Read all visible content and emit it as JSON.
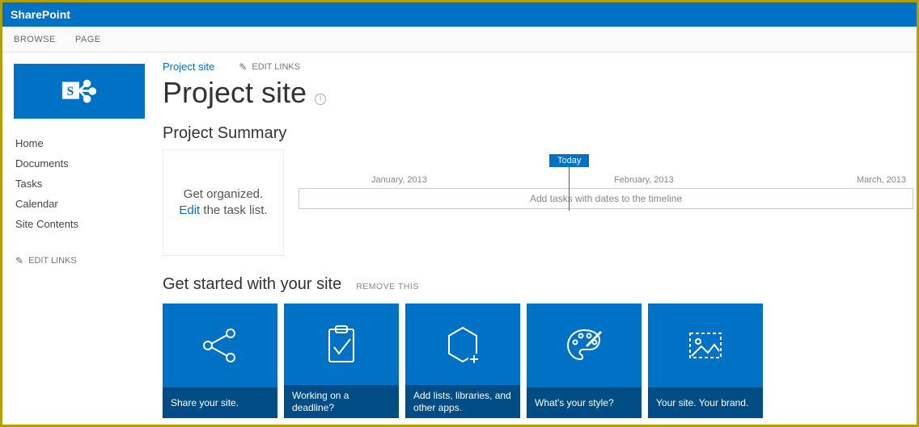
{
  "suitebar": {
    "product": "SharePoint"
  },
  "ribbon": {
    "browse": "BROWSE",
    "page": "PAGE"
  },
  "nav": {
    "items": [
      {
        "label": "Home"
      },
      {
        "label": "Documents"
      },
      {
        "label": "Tasks"
      },
      {
        "label": "Calendar"
      },
      {
        "label": "Site Contents"
      }
    ],
    "edit_links": "EDIT LINKS"
  },
  "topnav": {
    "site_link": "Project site",
    "edit_links": "EDIT LINKS"
  },
  "page": {
    "title": "Project site"
  },
  "project_summary": {
    "heading": "Project Summary",
    "organize_prefix": "Get organized.",
    "organize_link": "Edit",
    "organize_suffix": " the task list.",
    "today_label": "Today",
    "months": {
      "jan": "January, 2013",
      "feb": "February, 2013",
      "mar": "March, 2013"
    },
    "timeline_placeholder": "Add tasks with dates to the timeline"
  },
  "get_started": {
    "heading": "Get started with your site",
    "remove": "REMOVE THIS",
    "tiles": [
      {
        "caption": "Share your site."
      },
      {
        "caption": "Working on a deadline?"
      },
      {
        "caption": "Add lists, libraries, and other apps."
      },
      {
        "caption": "What's your style?"
      },
      {
        "caption": "Your site. Your brand."
      }
    ]
  }
}
